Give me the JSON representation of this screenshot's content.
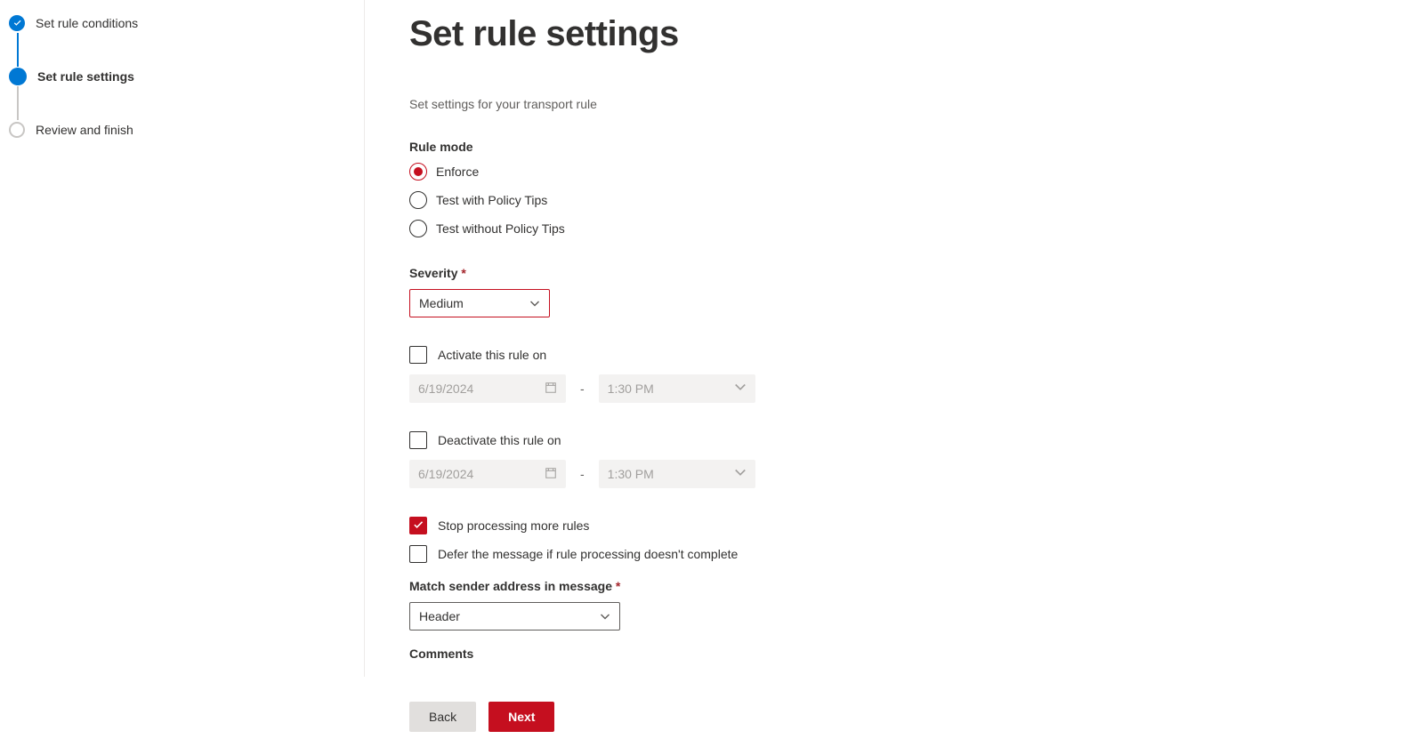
{
  "steps": {
    "completed": "Set rule conditions",
    "current": "Set rule settings",
    "pending": "Review and finish"
  },
  "page": {
    "title": "Set rule settings",
    "subtitle": "Set settings for your transport rule"
  },
  "ruleMode": {
    "label": "Rule mode",
    "options": {
      "enforce": "Enforce",
      "testWith": "Test with Policy Tips",
      "testWithout": "Test without Policy Tips"
    }
  },
  "severity": {
    "label": "Severity",
    "value": "Medium"
  },
  "activate": {
    "label": "Activate this rule on",
    "date": "6/19/2024",
    "time": "1:30 PM"
  },
  "deactivate": {
    "label": "Deactivate this rule on",
    "date": "6/19/2024",
    "time": "1:30 PM"
  },
  "processing": {
    "stop": "Stop processing more rules",
    "defer": "Defer the message if rule processing doesn't complete"
  },
  "matchSender": {
    "label": "Match sender address in message",
    "value": "Header"
  },
  "comments": {
    "label": "Comments"
  },
  "footer": {
    "back": "Back",
    "next": "Next"
  },
  "dash": "-"
}
